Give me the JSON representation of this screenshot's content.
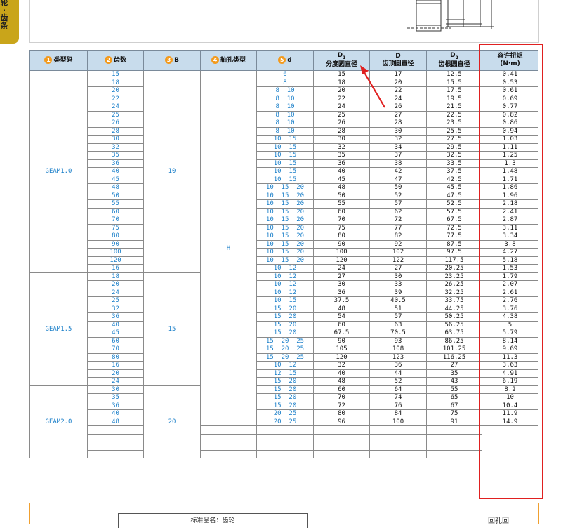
{
  "side_tab": {
    "chars": [
      "轮",
      "·",
      "齿",
      "条"
    ]
  },
  "table": {
    "headers": [
      {
        "num": "1",
        "text": "类型码"
      },
      {
        "num": "2",
        "text": "齿数"
      },
      {
        "num": "3",
        "text": "B"
      },
      {
        "num": "4",
        "text": "轴孔类型"
      },
      {
        "num": "5",
        "text": "d"
      },
      {
        "sym": "D",
        "sub": "1",
        "text": "分度圆直径"
      },
      {
        "sym": "D",
        "sub": "",
        "text": "齿顶圆直径"
      },
      {
        "sym": "D",
        "sub": "2",
        "text": "齿根圆直径"
      },
      {
        "text": "容许扭矩",
        "text2": "(N·m)"
      }
    ],
    "groups": [
      {
        "code": "GEAM1.0",
        "b": "10",
        "rows": 25
      },
      {
        "code": "GEAM1.5",
        "b": "15",
        "rows": 14
      },
      {
        "code": "GEAM2.0",
        "b": "20",
        "rows": 9
      }
    ],
    "shaft_type": "H",
    "rows": [
      [
        "15",
        "6",
        "15",
        "17",
        "12.5",
        "0.41"
      ],
      [
        "18",
        "8",
        "18",
        "20",
        "15.5",
        "0.53"
      ],
      [
        "20",
        "8  10",
        "20",
        "22",
        "17.5",
        "0.61"
      ],
      [
        "22",
        "8  10",
        "22",
        "24",
        "19.5",
        "0.69"
      ],
      [
        "24",
        "8  10",
        "24",
        "26",
        "21.5",
        "0.77"
      ],
      [
        "25",
        "8  10",
        "25",
        "27",
        "22.5",
        "0.82"
      ],
      [
        "26",
        "8  10",
        "26",
        "28",
        "23.5",
        "0.86"
      ],
      [
        "28",
        "8  10",
        "28",
        "30",
        "25.5",
        "0.94"
      ],
      [
        "30",
        "10  15",
        "30",
        "32",
        "27.5",
        "1.03"
      ],
      [
        "32",
        "10  15",
        "32",
        "34",
        "29.5",
        "1.11"
      ],
      [
        "35",
        "10  15",
        "35",
        "37",
        "32.5",
        "1.25"
      ],
      [
        "36",
        "10  15",
        "36",
        "38",
        "33.5",
        "1.3"
      ],
      [
        "40",
        "10  15",
        "40",
        "42",
        "37.5",
        "1.48"
      ],
      [
        "45",
        "10  15",
        "45",
        "47",
        "42.5",
        "1.71"
      ],
      [
        "48",
        "10  15  20",
        "48",
        "50",
        "45.5",
        "1.86"
      ],
      [
        "50",
        "10  15  20",
        "50",
        "52",
        "47.5",
        "1.96"
      ],
      [
        "55",
        "10  15  20",
        "55",
        "57",
        "52.5",
        "2.18"
      ],
      [
        "60",
        "10  15  20",
        "60",
        "62",
        "57.5",
        "2.41"
      ],
      [
        "70",
        "10  15  20",
        "70",
        "72",
        "67.5",
        "2.87"
      ],
      [
        "75",
        "10  15  20",
        "75",
        "77",
        "72.5",
        "3.11"
      ],
      [
        "80",
        "10  15  20",
        "80",
        "82",
        "77.5",
        "3.34"
      ],
      [
        "90",
        "10  15  20",
        "90",
        "92",
        "87.5",
        "3.8"
      ],
      [
        "100",
        "10  15  20",
        "100",
        "102",
        "97.5",
        "4.27"
      ],
      [
        "120",
        "10  15  20",
        "120",
        "122",
        "117.5",
        "5.18"
      ],
      [
        "16",
        "10  12",
        "24",
        "27",
        "20.25",
        "1.53"
      ],
      [
        "18",
        "10  12",
        "27",
        "30",
        "23.25",
        "1.79"
      ],
      [
        "20",
        "10  12",
        "30",
        "33",
        "26.25",
        "2.07"
      ],
      [
        "24",
        "10  12",
        "36",
        "39",
        "32.25",
        "2.61"
      ],
      [
        "25",
        "10  15",
        "37.5",
        "40.5",
        "33.75",
        "2.76"
      ],
      [
        "32",
        "15  20",
        "48",
        "51",
        "44.25",
        "3.76"
      ],
      [
        "36",
        "15  20",
        "54",
        "57",
        "50.25",
        "4.38"
      ],
      [
        "40",
        "15  20",
        "60",
        "63",
        "56.25",
        "5"
      ],
      [
        "45",
        "15  20",
        "67.5",
        "70.5",
        "63.75",
        "5.79"
      ],
      [
        "60",
        "15  20  25",
        "90",
        "93",
        "86.25",
        "8.14"
      ],
      [
        "70",
        "15  20  25",
        "105",
        "108",
        "101.25",
        "9.69"
      ],
      [
        "80",
        "15  20  25",
        "120",
        "123",
        "116.25",
        "11.3"
      ],
      [
        "16",
        "10  12",
        "32",
        "36",
        "27",
        "3.63"
      ],
      [
        "20",
        "12  15",
        "40",
        "44",
        "35",
        "4.91"
      ],
      [
        "24",
        "15  20",
        "48",
        "52",
        "43",
        "6.19"
      ],
      [
        "30",
        "15  20",
        "60",
        "64",
        "55",
        "8.2"
      ],
      [
        "35",
        "15  20",
        "70",
        "74",
        "65",
        "10"
      ],
      [
        "36",
        "15  20",
        "72",
        "76",
        "67",
        "10.4"
      ],
      [
        "40",
        "20  25",
        "80",
        "84",
        "75",
        "11.9"
      ],
      [
        "48",
        "20  25",
        "96",
        "100",
        "91",
        "14.9"
      ]
    ]
  },
  "footer": {
    "inner_title": "标准品名：齿轮",
    "qr_label": "回孔回"
  }
}
